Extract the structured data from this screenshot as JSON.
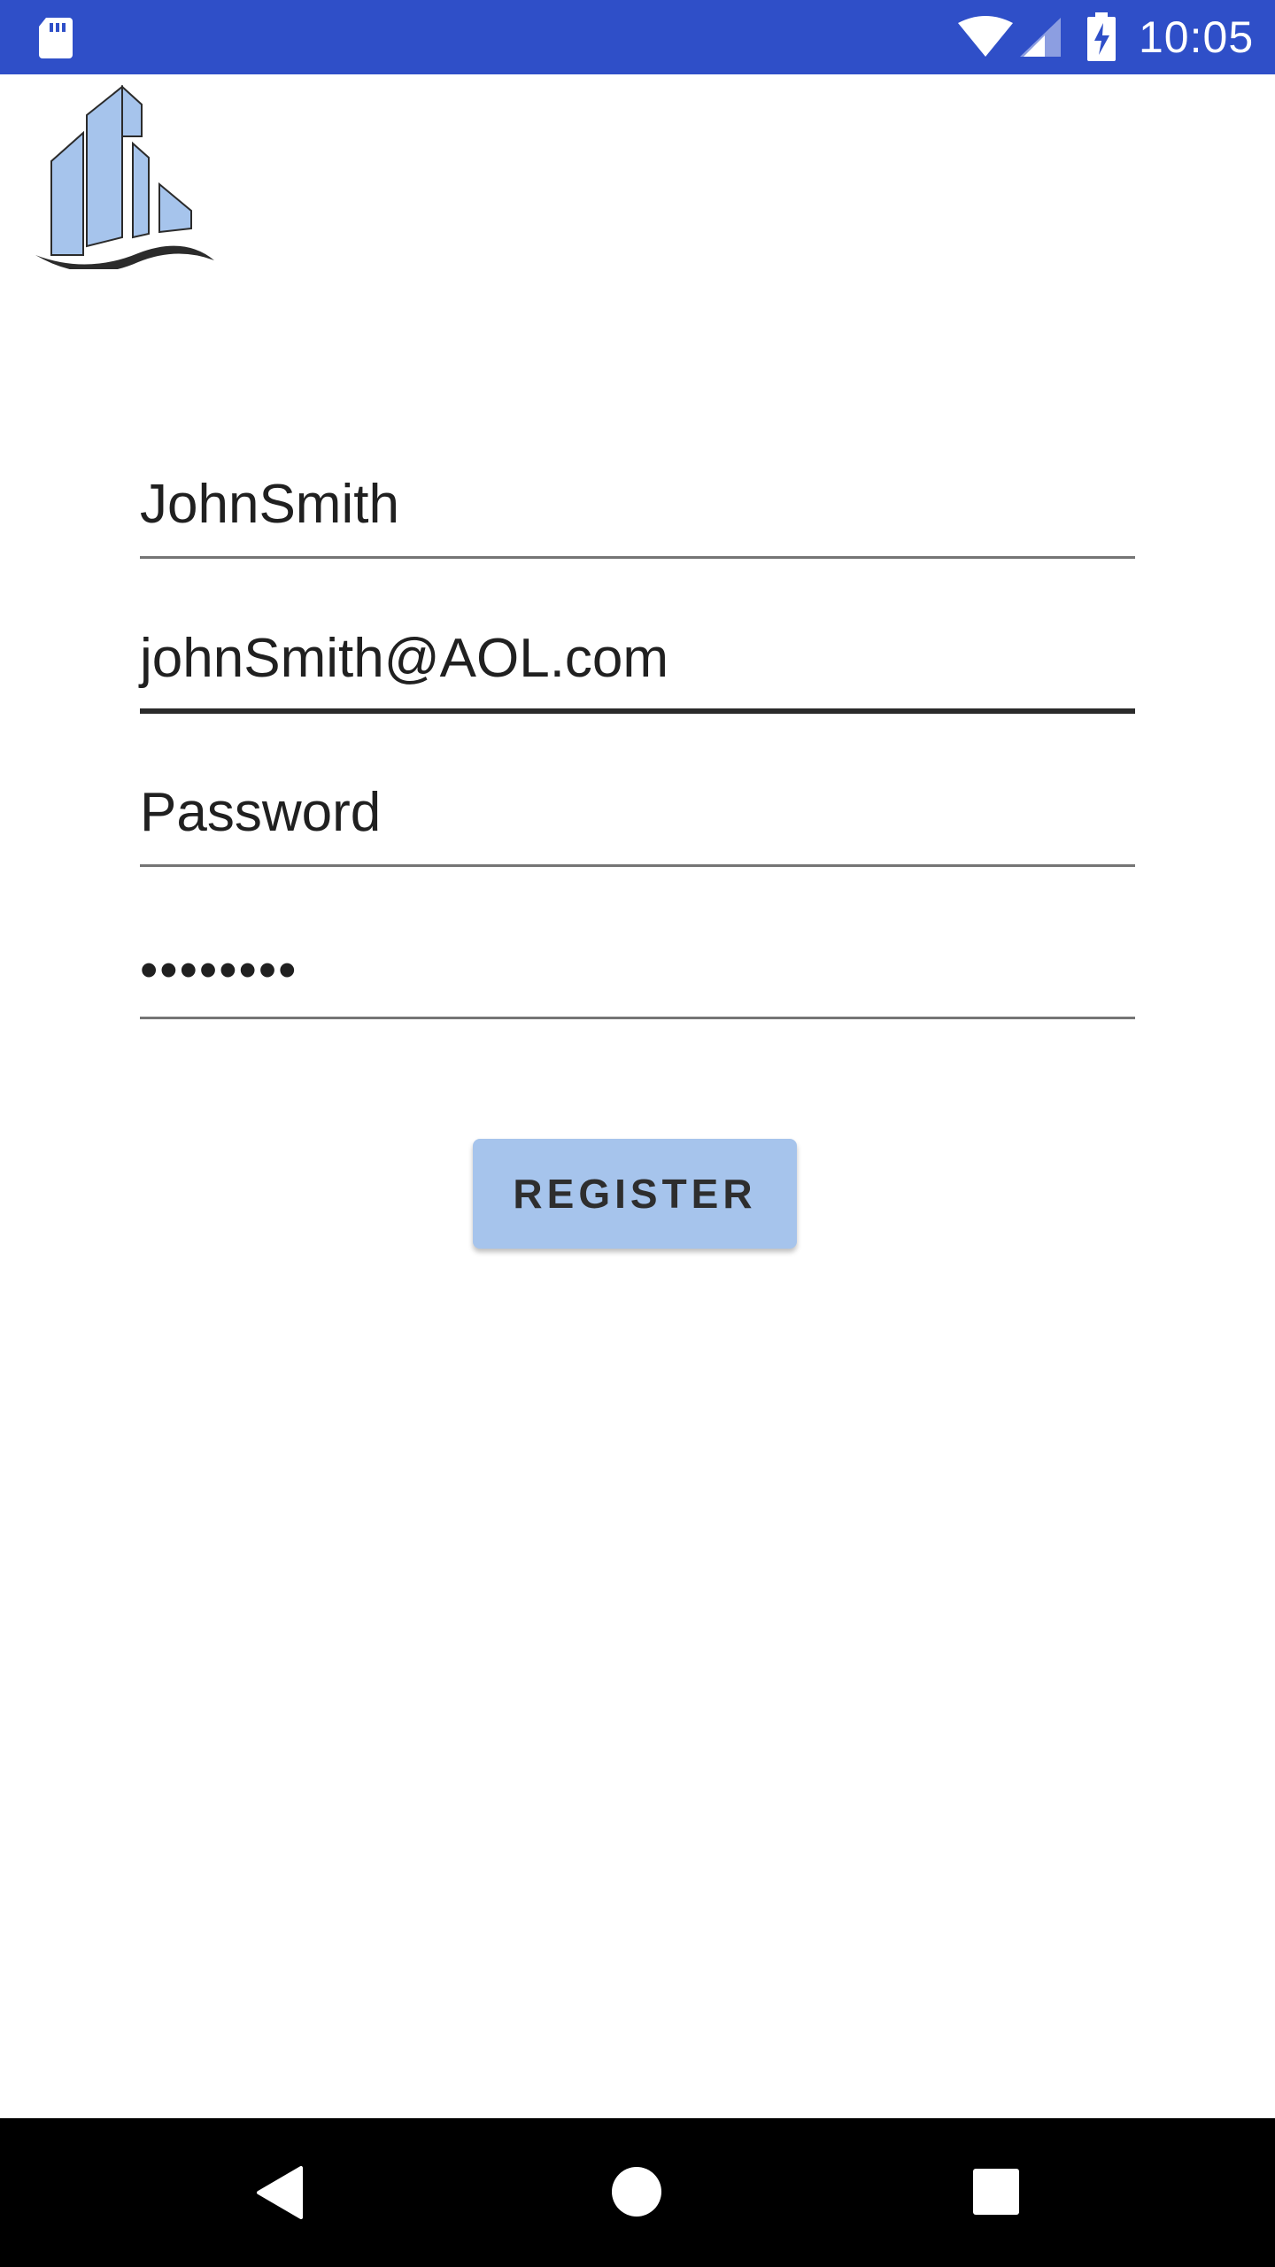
{
  "status_bar": {
    "time": "10:05",
    "background_color": "#2f4fc8",
    "icons": [
      "sd-card-icon",
      "wifi-icon",
      "cell-signal-icon",
      "battery-charging-icon"
    ]
  },
  "logo": {
    "icon": "building-logo-icon",
    "colors": [
      "#a6c4ec",
      "#2b2b2b"
    ]
  },
  "form": {
    "username_value": "JohnSmith",
    "email_value": "johnSmith@AOL.com",
    "password_label_value": "Password",
    "password_masked": "••••••••"
  },
  "register_button": {
    "label": "REGISTER",
    "background_color": "#a6c4ec"
  },
  "nav_bar": {
    "icons": [
      "back-icon",
      "home-icon",
      "recent-apps-icon"
    ]
  }
}
